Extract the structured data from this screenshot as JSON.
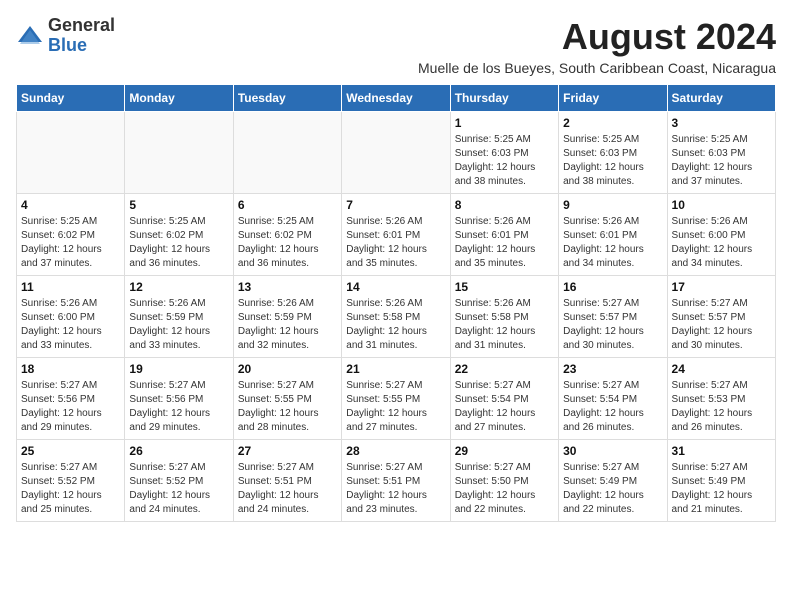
{
  "logo": {
    "text_general": "General",
    "text_blue": "Blue"
  },
  "header": {
    "month_year": "August 2024",
    "location": "Muelle de los Bueyes, South Caribbean Coast, Nicaragua"
  },
  "weekdays": [
    "Sunday",
    "Monday",
    "Tuesday",
    "Wednesday",
    "Thursday",
    "Friday",
    "Saturday"
  ],
  "weeks": [
    [
      {
        "day": "",
        "info": ""
      },
      {
        "day": "",
        "info": ""
      },
      {
        "day": "",
        "info": ""
      },
      {
        "day": "",
        "info": ""
      },
      {
        "day": "1",
        "info": "Sunrise: 5:25 AM\nSunset: 6:03 PM\nDaylight: 12 hours\nand 38 minutes."
      },
      {
        "day": "2",
        "info": "Sunrise: 5:25 AM\nSunset: 6:03 PM\nDaylight: 12 hours\nand 38 minutes."
      },
      {
        "day": "3",
        "info": "Sunrise: 5:25 AM\nSunset: 6:03 PM\nDaylight: 12 hours\nand 37 minutes."
      }
    ],
    [
      {
        "day": "4",
        "info": "Sunrise: 5:25 AM\nSunset: 6:02 PM\nDaylight: 12 hours\nand 37 minutes."
      },
      {
        "day": "5",
        "info": "Sunrise: 5:25 AM\nSunset: 6:02 PM\nDaylight: 12 hours\nand 36 minutes."
      },
      {
        "day": "6",
        "info": "Sunrise: 5:25 AM\nSunset: 6:02 PM\nDaylight: 12 hours\nand 36 minutes."
      },
      {
        "day": "7",
        "info": "Sunrise: 5:26 AM\nSunset: 6:01 PM\nDaylight: 12 hours\nand 35 minutes."
      },
      {
        "day": "8",
        "info": "Sunrise: 5:26 AM\nSunset: 6:01 PM\nDaylight: 12 hours\nand 35 minutes."
      },
      {
        "day": "9",
        "info": "Sunrise: 5:26 AM\nSunset: 6:01 PM\nDaylight: 12 hours\nand 34 minutes."
      },
      {
        "day": "10",
        "info": "Sunrise: 5:26 AM\nSunset: 6:00 PM\nDaylight: 12 hours\nand 34 minutes."
      }
    ],
    [
      {
        "day": "11",
        "info": "Sunrise: 5:26 AM\nSunset: 6:00 PM\nDaylight: 12 hours\nand 33 minutes."
      },
      {
        "day": "12",
        "info": "Sunrise: 5:26 AM\nSunset: 5:59 PM\nDaylight: 12 hours\nand 33 minutes."
      },
      {
        "day": "13",
        "info": "Sunrise: 5:26 AM\nSunset: 5:59 PM\nDaylight: 12 hours\nand 32 minutes."
      },
      {
        "day": "14",
        "info": "Sunrise: 5:26 AM\nSunset: 5:58 PM\nDaylight: 12 hours\nand 31 minutes."
      },
      {
        "day": "15",
        "info": "Sunrise: 5:26 AM\nSunset: 5:58 PM\nDaylight: 12 hours\nand 31 minutes."
      },
      {
        "day": "16",
        "info": "Sunrise: 5:27 AM\nSunset: 5:57 PM\nDaylight: 12 hours\nand 30 minutes."
      },
      {
        "day": "17",
        "info": "Sunrise: 5:27 AM\nSunset: 5:57 PM\nDaylight: 12 hours\nand 30 minutes."
      }
    ],
    [
      {
        "day": "18",
        "info": "Sunrise: 5:27 AM\nSunset: 5:56 PM\nDaylight: 12 hours\nand 29 minutes."
      },
      {
        "day": "19",
        "info": "Sunrise: 5:27 AM\nSunset: 5:56 PM\nDaylight: 12 hours\nand 29 minutes."
      },
      {
        "day": "20",
        "info": "Sunrise: 5:27 AM\nSunset: 5:55 PM\nDaylight: 12 hours\nand 28 minutes."
      },
      {
        "day": "21",
        "info": "Sunrise: 5:27 AM\nSunset: 5:55 PM\nDaylight: 12 hours\nand 27 minutes."
      },
      {
        "day": "22",
        "info": "Sunrise: 5:27 AM\nSunset: 5:54 PM\nDaylight: 12 hours\nand 27 minutes."
      },
      {
        "day": "23",
        "info": "Sunrise: 5:27 AM\nSunset: 5:54 PM\nDaylight: 12 hours\nand 26 minutes."
      },
      {
        "day": "24",
        "info": "Sunrise: 5:27 AM\nSunset: 5:53 PM\nDaylight: 12 hours\nand 26 minutes."
      }
    ],
    [
      {
        "day": "25",
        "info": "Sunrise: 5:27 AM\nSunset: 5:52 PM\nDaylight: 12 hours\nand 25 minutes."
      },
      {
        "day": "26",
        "info": "Sunrise: 5:27 AM\nSunset: 5:52 PM\nDaylight: 12 hours\nand 24 minutes."
      },
      {
        "day": "27",
        "info": "Sunrise: 5:27 AM\nSunset: 5:51 PM\nDaylight: 12 hours\nand 24 minutes."
      },
      {
        "day": "28",
        "info": "Sunrise: 5:27 AM\nSunset: 5:51 PM\nDaylight: 12 hours\nand 23 minutes."
      },
      {
        "day": "29",
        "info": "Sunrise: 5:27 AM\nSunset: 5:50 PM\nDaylight: 12 hours\nand 22 minutes."
      },
      {
        "day": "30",
        "info": "Sunrise: 5:27 AM\nSunset: 5:49 PM\nDaylight: 12 hours\nand 22 minutes."
      },
      {
        "day": "31",
        "info": "Sunrise: 5:27 AM\nSunset: 5:49 PM\nDaylight: 12 hours\nand 21 minutes."
      }
    ]
  ]
}
